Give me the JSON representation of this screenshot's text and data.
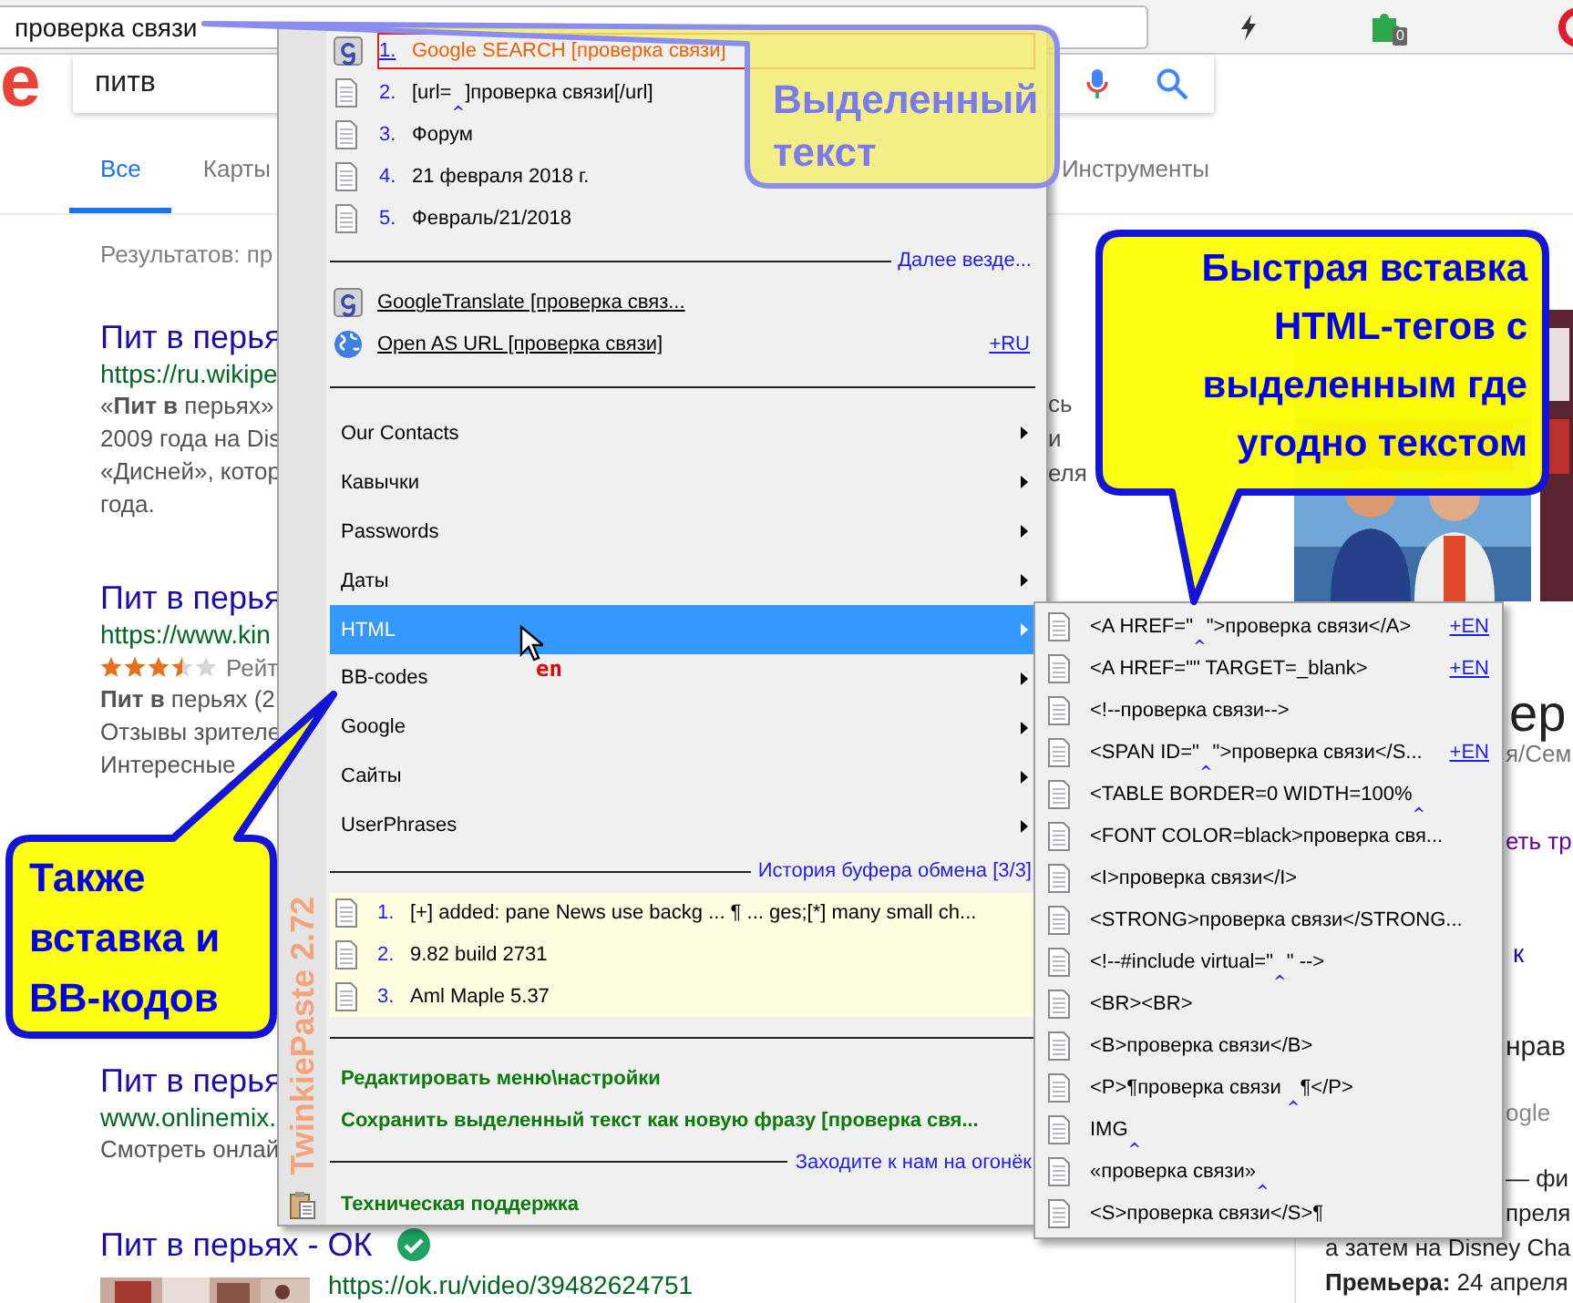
{
  "browser": {
    "address": "проверка связи",
    "extension_badge": "0"
  },
  "google": {
    "logo": "e",
    "query": "питв",
    "tabs": [
      {
        "label": "Все",
        "selected": true
      },
      {
        "label": "Карты",
        "selected": false
      },
      {
        "label": "Инструменты",
        "selected": false
      }
    ],
    "result_count": "Результатов: пр",
    "results": [
      {
        "title": "Пит в перья",
        "url": "https://ru.wikipe",
        "snippet": [
          "«**Пит в** перьях»",
          "2009 года на Dis",
          "«Дисней», котор",
          "года."
        ]
      },
      {
        "title": "Пит в перья",
        "url": "https://www.kin",
        "rating": {
          "stars": 3.5,
          "label": "Рейт"
        },
        "snippet": [
          "**Пит в** перьях (2",
          "Отзывы зрителе",
          "Интересные"
        ]
      },
      {
        "title": "Пит в перья",
        "url": "www.onlinemix.",
        "snippet": [
          "Смотреть онлай"
        ]
      },
      {
        "title": "Пит в перьях - ОК",
        "verified": true,
        "url": "https://ok.ru/video/39482624751",
        "thumbnail": {
          "kind": "picture"
        }
      }
    ],
    "line_ends": [
      "сь",
      "и",
      "еля"
    ],
    "poster": {
      "kind": "picture"
    },
    "panel": {
      "title": "ер",
      "subtitle": "я/Сем",
      "link": "еть тр",
      "mark": "к",
      "question": "нрав",
      "source": "ogle",
      "description": [
        "— фи",
        "преля",
        "а затем на Disney Cha"
      ],
      "premiere": "**Премьера:** 24 апреля"
    }
  },
  "menu": {
    "brand": "TwinkiePaste 2.72",
    "recent": [
      {
        "number": "1.",
        "text": "Google SEARCH [проверка связи]",
        "kind": "tile",
        "selected": true
      },
      {
        "number": "2.",
        "text": "[url=$_{‸}$]проверка связи[/url]",
        "kind": "document",
        "selected": false
      },
      {
        "number": "3.",
        "text": "Форум",
        "kind": "document",
        "selected": false
      },
      {
        "number": "4.",
        "text": "21 февраля 2018 г.",
        "kind": "document",
        "selected": false
      },
      {
        "number": "5.",
        "text": "Февраль/21/2018",
        "kind": "document",
        "selected": false
      }
    ],
    "more": "Далее везде...",
    "links": [
      {
        "text": "GoogleTranslate [проверка связ...",
        "kind": "tile"
      },
      {
        "text": "Open AS URL [проверка связи]",
        "kind": "globe",
        "shortcut": "+RU"
      }
    ],
    "submenus": [
      {
        "label": "Our Contacts",
        "selected": false
      },
      {
        "label": "Кавычки",
        "selected": false
      },
      {
        "label": "Passwords",
        "selected": false
      },
      {
        "label": "Даты",
        "selected": false
      },
      {
        "label": "HTML",
        "selected": true
      },
      {
        "label": "BB-codes",
        "selected": false
      },
      {
        "label": "Google",
        "selected": false
      },
      {
        "label": "Сайты",
        "selected": false
      },
      {
        "label": "UserPhrases",
        "selected": false
      }
    ],
    "pointer_hint": "en",
    "history_title": "История буфера обмена [3/3]",
    "history": [
      {
        "number": "1.",
        "text": "[+] added: pane News use backg ... ¶ ... ges;[*] many small ch..."
      },
      {
        "number": "2.",
        "text": "9.82 build 2731"
      },
      {
        "number": "3.",
        "text": "Aml Maple 5.37"
      }
    ],
    "actions": [
      "Редактировать меню\\настройки",
      "Сохранить выделенный текст как новую фразу [проверка свя..."
    ],
    "visit": "Заходите к нам на огонёк",
    "support": "Техническая поддержка"
  },
  "html_menu": [
    {
      "text": "<A HREF=\"$_{‸}$\">проверка связи</A>",
      "shortcut": "+EN"
    },
    {
      "text": "<A HREF=\"\" TARGET=_blank>",
      "shortcut": "+EN"
    },
    {
      "text": "<!--проверка связи-->"
    },
    {
      "text": "<SPAN ID=\"$_{‸}$\">проверка связи</S...",
      "shortcut": "+EN"
    },
    {
      "text": "<TABLE BORDER=0 WIDTH=100%$_{‸}$"
    },
    {
      "text": "<FONT COLOR=black>проверка свя..."
    },
    {
      "text": "<I>проверка связи</I>"
    },
    {
      "text": "<STRONG>проверка связи</STRONG..."
    },
    {
      "text": "<!--#include virtual=\"$_{‸}$\" -->"
    },
    {
      "text": "<BR><BR>"
    },
    {
      "text": "<B>проверка связи</B>"
    },
    {
      "text": "<P>¶проверка связи $_{‸}$¶</P>"
    },
    {
      "text": "IMG$_{‸}$"
    },
    {
      "text": "«проверка связи»$_{‸}$"
    },
    {
      "text": "<S>проверка связи</S>¶"
    }
  ],
  "callouts": [
    {
      "text": "Выделенный\nтекст",
      "kind": "faded"
    },
    {
      "text": "Быстрая вставка\nHTML-тегов с\nвыделенным где\nугодно текстом",
      "kind": "bold"
    },
    {
      "text": "Также\nвставка и\nBB-кодов",
      "kind": "bold"
    }
  ]
}
